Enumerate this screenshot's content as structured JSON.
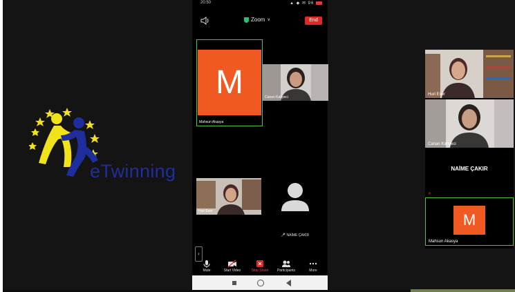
{
  "logo": {
    "text": "eTwinning"
  },
  "status_bar": {
    "time": "20:50",
    "icons": "▲ ◆ ✉ 96"
  },
  "meeting": {
    "title": "Zoom",
    "end_label": "End"
  },
  "phone_tiles": [
    {
      "name": "Mahsun Akasya",
      "initial": "M"
    },
    {
      "name": "Canan Kahyeci"
    },
    {
      "name": "Huri Eser"
    },
    {
      "name": "NAİME ÇAKIR"
    }
  ],
  "toolbar": [
    {
      "label": "Mute",
      "icon": "microphone-icon"
    },
    {
      "label": "Start Video",
      "icon": "video-off-icon"
    },
    {
      "label": "Stop Share",
      "icon": "stop-share-icon"
    },
    {
      "label": "Participants",
      "icon": "participants-icon"
    },
    {
      "label": "More",
      "icon": "more-icon"
    }
  ],
  "gallery": [
    {
      "name": "Huri Eser"
    },
    {
      "name": "Canan Kahyeci"
    },
    {
      "name": "NAİME ÇAKIR"
    },
    {
      "name": "Mahsun Akasya",
      "initial": "M"
    }
  ],
  "colors": {
    "avatar_orange": "#f05a22",
    "end_red": "#e02828",
    "active_speaker_green": "#57c234",
    "logo_blue": "#1f2e9c",
    "logo_yellow": "#f2e21c"
  }
}
